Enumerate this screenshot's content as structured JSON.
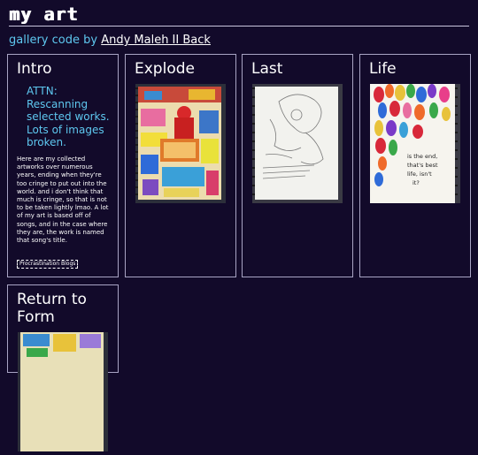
{
  "header": {
    "logo": "my art",
    "credit_prefix": "gallery code by",
    "credit_author": "Andy Maleh II Back"
  },
  "intro": {
    "title": "Intro",
    "attn": "ATTN: Rescanning selected works. Lots of images broken.",
    "body": "Here are my collected artworks over numerous years, ending when they're too cringe to put out into the world. and i don't think that much is cringe, so that is not to be taken lightly lmao. A lot of my art is based off of songs, and in the case where they are, the work is named that song's title.",
    "button_label": "Procrastination Blogs"
  },
  "cards": [
    {
      "title": "Explode",
      "image": "colorful-collage-thumbnail"
    },
    {
      "title": "Last",
      "image": "pencil-sketch-thumbnail"
    },
    {
      "title": "Life",
      "image": "rainbow-petals-thumbnail",
      "image_caption": "is the end, that's best life, isn't it?"
    },
    {
      "title": "Return to Form",
      "image": "collage-partial-thumbnail"
    }
  ],
  "colors": {
    "background": "#120a2a",
    "accent": "#5ec8f0",
    "border": "#a9a4c4"
  }
}
